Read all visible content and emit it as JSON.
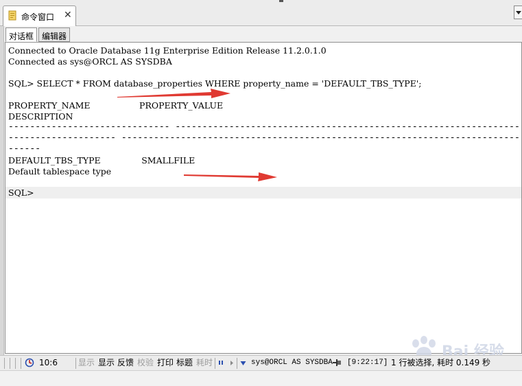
{
  "window": {
    "tab_title": "命令窗口",
    "close_glyph": "✕"
  },
  "sub_tabs": [
    {
      "label": "对话框",
      "active": true
    },
    {
      "label": "编辑器",
      "active": false
    }
  ],
  "console": {
    "lines": [
      "Connected to Oracle Database 11g Enterprise Edition Release 11.2.0.1.0",
      "Connected as sys@ORCL AS SYSDBA",
      "",
      "SQL> SELECT * FROM database_properties WHERE property_name = 'DEFAULT_TBS_TYPE';",
      "",
      "PROPERTY_NAME                  PROPERTY_VALUE",
      "DESCRIPTION",
      "------------------------------ --------------------------------------------------------------------------------",
      "-------------------- --------------------------------------------------------------------------------",
      "------",
      "DEFAULT_TBS_TYPE               SMALLFILE",
      "Default tablespace type",
      ""
    ],
    "prompt": "SQL>"
  },
  "status_bar": {
    "position": "10:6",
    "disabled_show": "显示",
    "show": "显示",
    "feedback": "反馈",
    "verify": "校验",
    "print": "打印",
    "headings": "标题",
    "timing": "耗时",
    "connection": "sys@ORCL AS SYSDBA",
    "time": "[9:22:17]",
    "message": "1 行被选择, 耗时 0.149 秒"
  },
  "watermark": {
    "text": "Bai 经验"
  },
  "colors": {
    "arrow": "#e03a32",
    "prompt_line": "#efefef",
    "panel_border": "#8f8f8f"
  }
}
